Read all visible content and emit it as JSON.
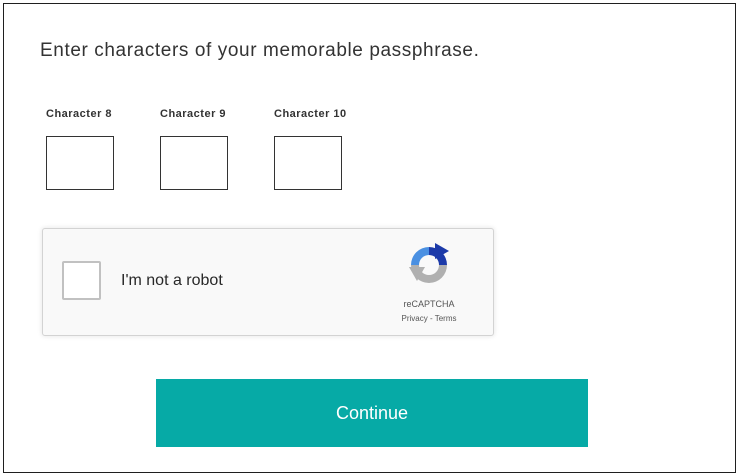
{
  "prompt": "Enter characters of your memorable passphrase.",
  "characters": [
    {
      "label": "Character 8",
      "value": ""
    },
    {
      "label": "Character 9",
      "value": ""
    },
    {
      "label": "Character 10",
      "value": ""
    }
  ],
  "captcha": {
    "label": "I'm not a robot",
    "brand": "reCAPTCHA",
    "privacy": "Privacy",
    "separator": " - ",
    "terms": "Terms",
    "checked": false
  },
  "continue_label": "Continue",
  "colors": {
    "button": "#06aaa6",
    "captcha_blue": "#1c3aa9",
    "captcha_light_blue": "#4a90e2",
    "captcha_grey": "#b0b0b0"
  }
}
